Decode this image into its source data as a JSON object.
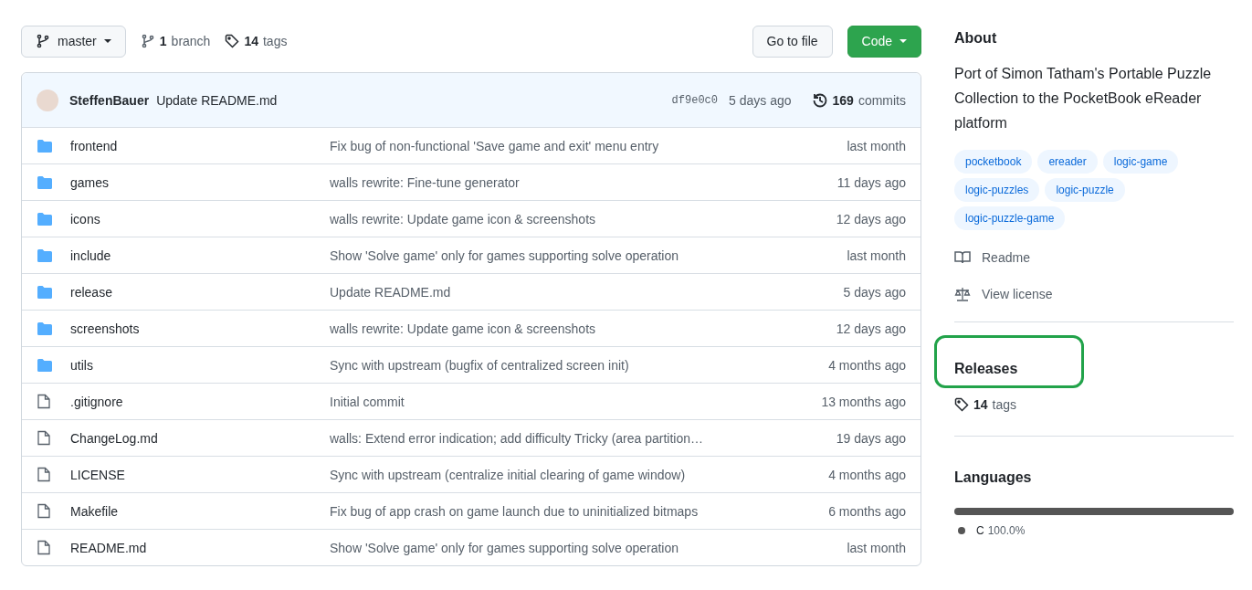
{
  "toolbar": {
    "branch": "master",
    "branches_count": "1",
    "branches_label": "branch",
    "tags_count": "14",
    "tags_label": "tags",
    "go_to_file": "Go to file",
    "code": "Code"
  },
  "latest_commit": {
    "author": "SteffenBauer",
    "message": "Update README.md",
    "sha": "df9e0c0",
    "time": "5 days ago",
    "commits_count": "169",
    "commits_label": "commits"
  },
  "files": [
    {
      "kind": "folder",
      "name": "frontend",
      "message": "Fix bug of non-functional 'Save game and exit' menu entry",
      "time": "last month"
    },
    {
      "kind": "folder",
      "name": "games",
      "message": "walls rewrite: Fine-tune generator",
      "time": "11 days ago"
    },
    {
      "kind": "folder",
      "name": "icons",
      "message": "walls rewrite: Update game icon & screenshots",
      "time": "12 days ago"
    },
    {
      "kind": "folder",
      "name": "include",
      "message": "Show 'Solve game' only for games supporting solve operation",
      "time": "last month"
    },
    {
      "kind": "folder",
      "name": "release",
      "message": "Update README.md",
      "time": "5 days ago"
    },
    {
      "kind": "folder",
      "name": "screenshots",
      "message": "walls rewrite: Update game icon & screenshots",
      "time": "12 days ago"
    },
    {
      "kind": "folder",
      "name": "utils",
      "message": "Sync with upstream (bugfix of centralized screen init)",
      "time": "4 months ago"
    },
    {
      "kind": "file",
      "name": ".gitignore",
      "message": "Initial commit",
      "time": "13 months ago"
    },
    {
      "kind": "file",
      "name": "ChangeLog.md",
      "message": "walls: Extend error indication; add difficulty Tricky (area partition…",
      "time": "19 days ago"
    },
    {
      "kind": "file",
      "name": "LICENSE",
      "message": "Sync with upstream (centralize initial clearing of game window)",
      "time": "4 months ago"
    },
    {
      "kind": "file",
      "name": "Makefile",
      "message": "Fix bug of app crash on game launch due to uninitialized bitmaps",
      "time": "6 months ago"
    },
    {
      "kind": "file",
      "name": "README.md",
      "message": "Show 'Solve game' only for games supporting solve operation",
      "time": "last month"
    }
  ],
  "about": {
    "title": "About",
    "description": "Port of Simon Tatham's Portable Puzzle Collection to the PocketBook eReader platform",
    "topics": [
      "pocketbook",
      "ereader",
      "logic-game",
      "logic-puzzles",
      "logic-puzzle",
      "logic-puzzle-game"
    ],
    "links": [
      {
        "kind": "readme",
        "label": "Readme"
      },
      {
        "kind": "license",
        "label": "View license"
      }
    ]
  },
  "releases": {
    "title": "Releases",
    "highlighted": true,
    "tags_count": "14",
    "tags_label": "tags"
  },
  "languages": {
    "title": "Languages",
    "items": [
      {
        "name": "C",
        "percent": "100.0%",
        "color": "#555555",
        "level": 1
      }
    ]
  }
}
